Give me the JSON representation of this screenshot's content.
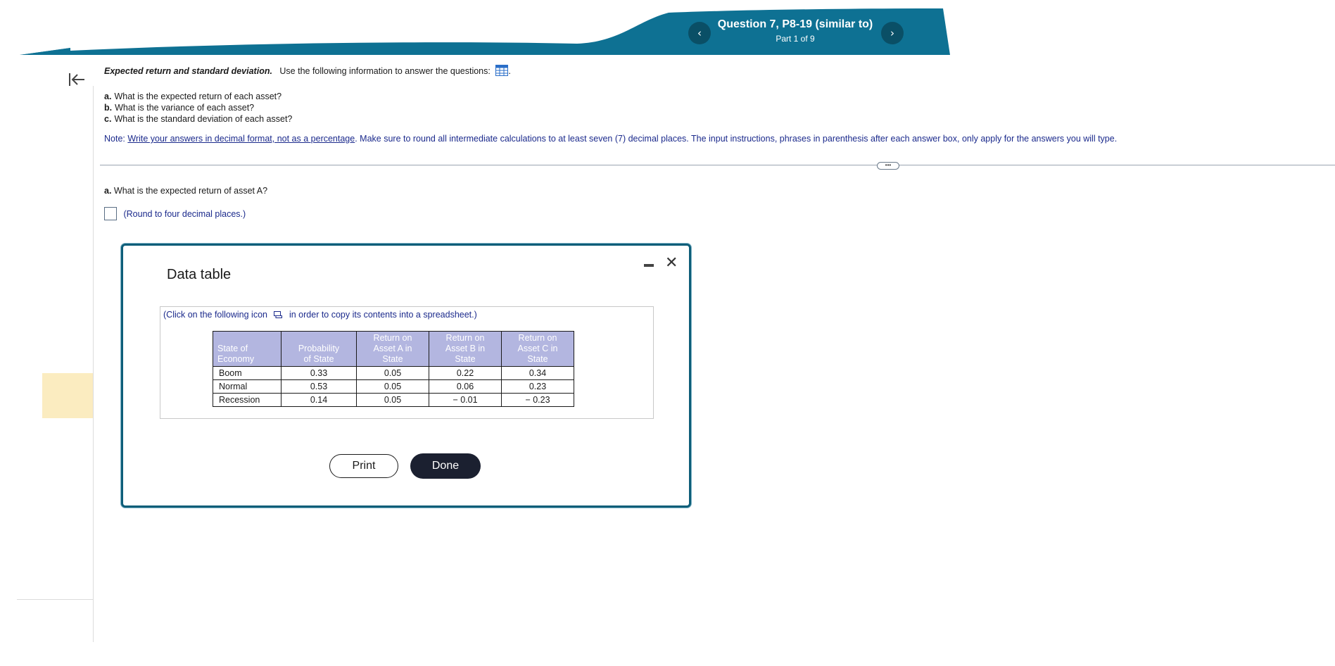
{
  "header": {
    "question_title": "Question 7, P8-19 (similar to)",
    "part_label": "Part 1 of 9",
    "prev_glyph": "‹",
    "next_glyph": "›",
    "brand_color": "#0e7193"
  },
  "problem": {
    "title": "Expected return and standard deviation.",
    "instruction": "Use the following information to answer the questions:",
    "questions": [
      {
        "label": "a.",
        "text": "What is the expected return of each asset?"
      },
      {
        "label": "b.",
        "text": "What is the variance of each asset?"
      },
      {
        "label": "c.",
        "text": "What is the standard deviation of each asset?"
      }
    ],
    "note_prefix": "Note:",
    "note_link": "Write your answers in decimal format, not as a percentage",
    "note_rest": ". Make sure to round all intermediate calculations to at least seven (7) decimal places. The input instructions, phrases in parenthesis after each answer box, only apply for the answers you will type.",
    "more_label": "•••"
  },
  "part_a": {
    "question_label": "a.",
    "question_text": "What is the expected return of asset A?",
    "answer_value": "",
    "answer_hint": "(Round to four decimal places.)"
  },
  "modal": {
    "title": "Data table",
    "copy_prefix": "(Click on the following icon",
    "copy_suffix": "in order to copy its contents into a spreadsheet.)",
    "headers": [
      [
        "State of",
        "Economy"
      ],
      [
        "Probability",
        "of State"
      ],
      [
        "Return on",
        "Asset A in",
        "State"
      ],
      [
        "Return on",
        "Asset B in",
        "State"
      ],
      [
        "Return on",
        "Asset C in",
        "State"
      ]
    ],
    "rows": [
      [
        "Boom",
        "0.33",
        "0.05",
        "0.22",
        "0.34"
      ],
      [
        "Normal",
        "0.53",
        "0.05",
        "0.06",
        "0.23"
      ],
      [
        "Recession",
        "0.14",
        "0.05",
        "− 0.01",
        "− 0.23"
      ]
    ],
    "print_label": "Print",
    "done_label": "Done",
    "close_glyph": "✕"
  }
}
